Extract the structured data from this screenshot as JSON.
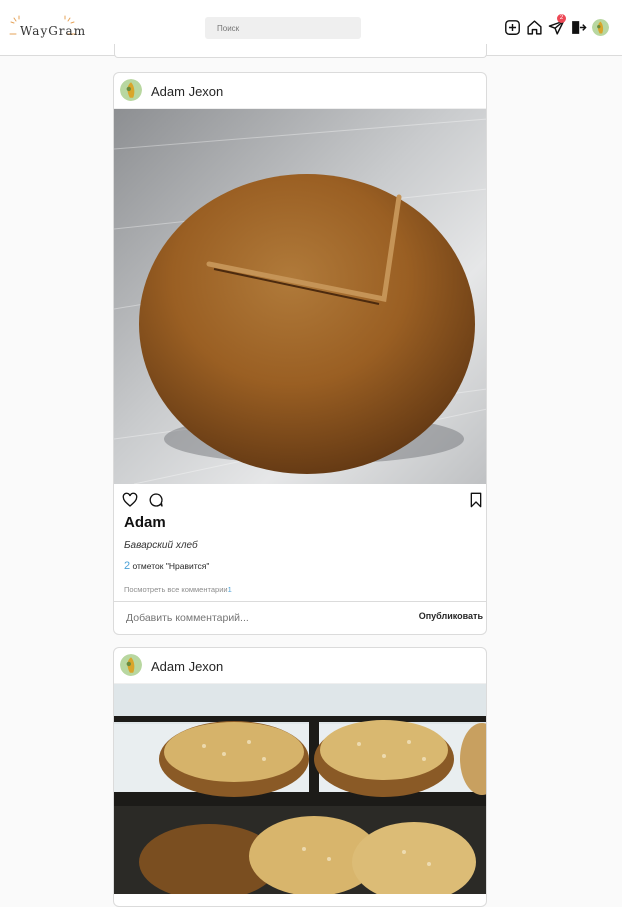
{
  "header": {
    "logo_text": "WayGram",
    "search_placeholder": "Поиск",
    "notifications_count": "2"
  },
  "icons": [
    "add-post-icon",
    "home-icon",
    "direct-icon",
    "logout-icon",
    "avatar"
  ],
  "posts": [
    {
      "author": "Adam Jexon",
      "caption_name": "Adam",
      "caption_text": "Баварский хлеб",
      "likes_count": "2",
      "likes_label": "отметок \"Нравится\"",
      "view_comments_label": "Посмотреть все комментарии",
      "comments_count": "1",
      "comment_placeholder": "Добавить комментарий...",
      "publish_label": "Опубликовать"
    },
    {
      "author": "Adam Jexon"
    }
  ],
  "colors": {
    "accent_blue": "#4aa0d6",
    "badge_red": "#ed4956",
    "border": "#dbdbdb"
  }
}
